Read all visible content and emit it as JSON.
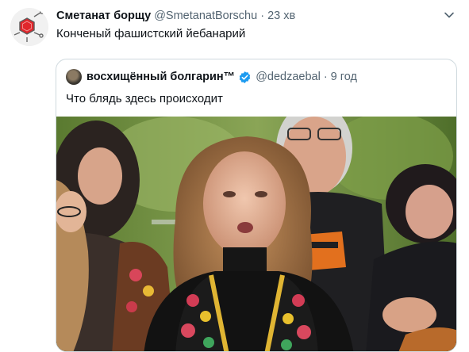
{
  "tweet": {
    "author_name": "Сметанат борщу",
    "author_handle": "@SmetanatBorschu",
    "separator": "·",
    "time": "23 хв",
    "text": "Конченый фашистский йебанарий"
  },
  "quoted": {
    "author_name": "восхищённый болгарин™",
    "author_handle": "@dedzaebal",
    "separator": "·",
    "time": "9 год",
    "text": "Что блядь здесь происходит"
  },
  "colors": {
    "verified": "#1d9bf0",
    "secondary_text": "#536471",
    "border": "#cfd9de",
    "avatar_red": "#e0262b"
  },
  "icons": {
    "more": "chevron-down-icon",
    "verified": "verified-badge-icon"
  }
}
